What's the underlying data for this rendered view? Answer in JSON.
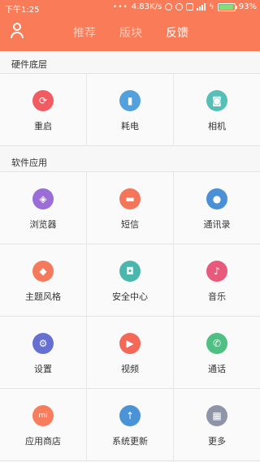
{
  "statusbar": {
    "time": "下午1:25",
    "speed": "4.83K/s",
    "battery": "93%"
  },
  "tabs": [
    {
      "label": "推荐"
    },
    {
      "label": "版块"
    },
    {
      "label": "反馈"
    }
  ],
  "sections": [
    {
      "title": "硬件底层",
      "rows": [
        [
          {
            "label": "重启",
            "icon": "restart-icon",
            "glyph": "⟳",
            "color": "#f25b62"
          },
          {
            "label": "耗电",
            "icon": "battery-icon",
            "glyph": "▮",
            "color": "#52a0dc"
          },
          {
            "label": "相机",
            "icon": "camera-icon",
            "glyph": "◙",
            "color": "#56bfb7"
          }
        ]
      ]
    },
    {
      "title": "软件应用",
      "rows": [
        [
          {
            "label": "浏览器",
            "icon": "browser-icon",
            "glyph": "◈",
            "color": "#9a6ed6"
          },
          {
            "label": "短信",
            "icon": "sms-icon",
            "glyph": "▬",
            "color": "#f4765a"
          },
          {
            "label": "通讯录",
            "icon": "contacts-icon",
            "glyph": "●",
            "color": "#4a90d6"
          }
        ],
        [
          {
            "label": "主题风格",
            "icon": "theme-icon",
            "glyph": "◆",
            "color": "#f57a5b"
          },
          {
            "label": "安全中心",
            "icon": "shield-icon",
            "glyph": "◘",
            "color": "#4bb6ad"
          },
          {
            "label": "音乐",
            "icon": "music-icon",
            "glyph": "♪",
            "color": "#e85a7c"
          }
        ],
        [
          {
            "label": "设置",
            "icon": "gear-icon",
            "glyph": "⚙",
            "color": "#6670d1"
          },
          {
            "label": "视频",
            "icon": "video-icon",
            "glyph": "▶",
            "color": "#f4685a"
          },
          {
            "label": "通话",
            "icon": "phone-icon",
            "glyph": "✆",
            "color": "#4fbf84"
          }
        ],
        [
          {
            "label": "应用商店",
            "icon": "store-icon",
            "glyph": "mi",
            "color": "#f77d5d"
          },
          {
            "label": "系统更新",
            "icon": "update-icon",
            "glyph": "↑",
            "color": "#4a93d6"
          },
          {
            "label": "更多",
            "icon": "more-icon",
            "glyph": "▦",
            "color": "#8f95a8"
          }
        ]
      ]
    }
  ]
}
